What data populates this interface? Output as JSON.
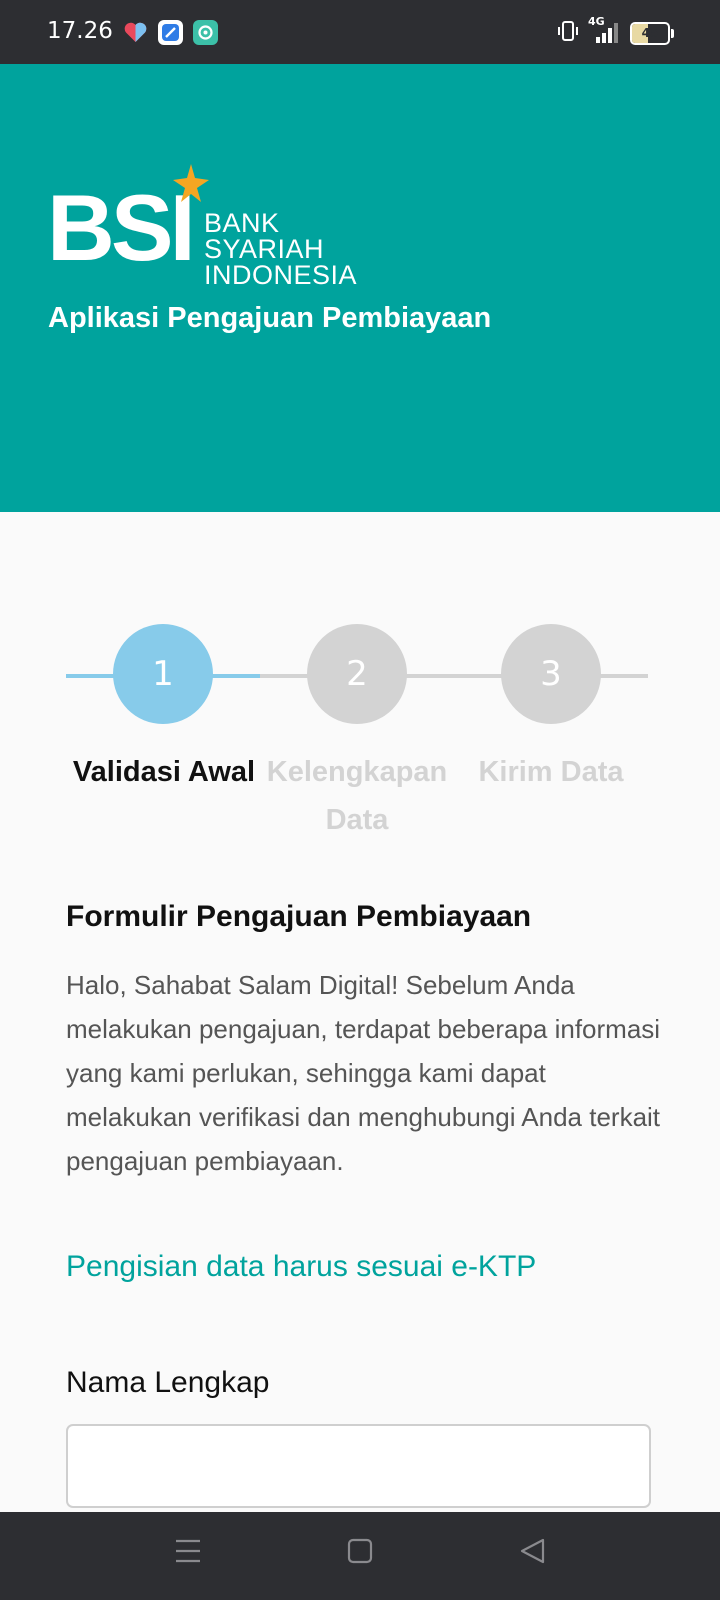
{
  "status_bar": {
    "time": "17.26",
    "network": "4G",
    "battery": "45",
    "battery_level": 45
  },
  "header": {
    "logo_text": "BSI",
    "logo_subtitle_line1": "BANK SYARIAH",
    "logo_subtitle_line2": "INDONESIA",
    "title": "Aplikasi Pengajuan Pembiayaan"
  },
  "stepper": {
    "steps": [
      {
        "number": "1",
        "label_line1": "Validasi Awal",
        "label_line2": "",
        "active": true
      },
      {
        "number": "2",
        "label_line1": "Kelengkapan",
        "label_line2": "Data",
        "active": false
      },
      {
        "number": "3",
        "label_line1": "Kirim Data",
        "label_line2": "",
        "active": false
      }
    ]
  },
  "form": {
    "title": "Formulir Pengajuan Pembiayaan",
    "description": "Halo, Sahabat Salam Digital! Sebelum Anda melakukan pengajuan, terdapat beberapa informasi yang kami perlukan, sehingga kami dapat melakukan verifikasi dan menghubungi Anda terkait pengajuan pembiayaan.",
    "notice": "Pengisian data harus sesuai e-KTP",
    "full_name_label": "Nama Lengkap",
    "full_name_value": ""
  },
  "colors": {
    "brand_teal": "#00a39d",
    "step_active": "#87cbea",
    "step_inactive": "#d3d3d3",
    "logo_star": "#f5a623"
  },
  "icons": [
    "heart-app-icon",
    "blue-app-icon",
    "chat-app-icon",
    "vibrate-icon",
    "signal-icon",
    "battery-icon",
    "menu-icon",
    "home-icon",
    "back-icon"
  ]
}
